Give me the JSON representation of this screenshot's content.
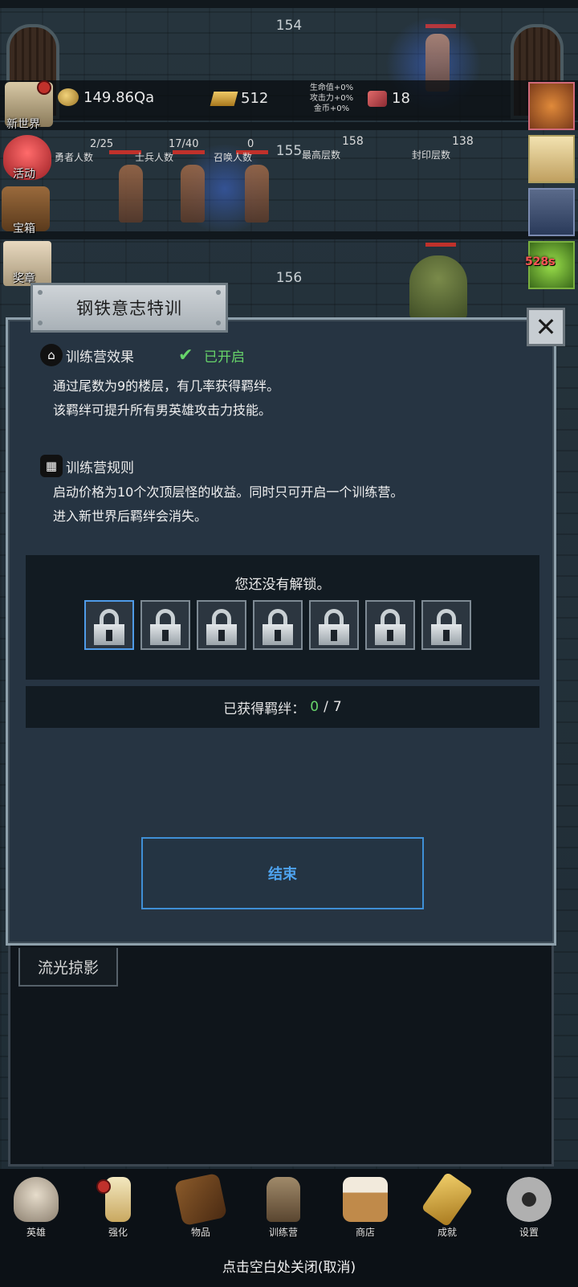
{
  "floors": {
    "f1": "154",
    "f2": "155",
    "f3": "156"
  },
  "resources": {
    "gold": "149.86Qa",
    "ingot": "512",
    "gem": "18"
  },
  "buffs": {
    "hp": "生命值+0%",
    "atk": "攻击力+0%",
    "gold": "金币+0%"
  },
  "stats": [
    {
      "value": "2/25",
      "label": "勇者人数"
    },
    {
      "value": "17/40",
      "label": "士兵人数"
    },
    {
      "value": "0",
      "label": "召唤人数"
    },
    {
      "value": "158",
      "label": "最高层数"
    },
    {
      "value": "138",
      "label": "封印层数"
    }
  ],
  "side_menu": {
    "new_world": "新世界",
    "event": "活动",
    "chest": "宝箱",
    "mail": "奖章"
  },
  "timer": "528s",
  "modal": {
    "title": "钢铁意志特训",
    "effect_title": "训练营效果",
    "status": "已开启",
    "effect_lines": [
      "通过尾数为9的楼层，有几率获得羁绊。",
      "该羁绊可提升所有男英雄攻击力技能。"
    ],
    "rules_title": "训练营规则",
    "rules_lines": [
      "启动价格为10个次顶层怪的收益。同时只可开启一个训练营。",
      "进入新世界后羁绊会消失。"
    ],
    "locked_text": "您还没有解锁。",
    "bond_label": "已获得羁绊：",
    "bond_current": "0",
    "bond_separator": "/",
    "bond_total": "7",
    "end_button": "结束",
    "close_icon": "✕"
  },
  "lower_tag": "流光掠影",
  "bottom_nav": [
    "英雄",
    "强化",
    "物品",
    "训练营",
    "商店",
    "成就",
    "设置"
  ],
  "footer_hint": "点击空白处关闭(取消)",
  "colors": {
    "accent_blue": "#4ea3ef",
    "enabled_green": "#67d46a",
    "modal_bg": "#263442"
  }
}
